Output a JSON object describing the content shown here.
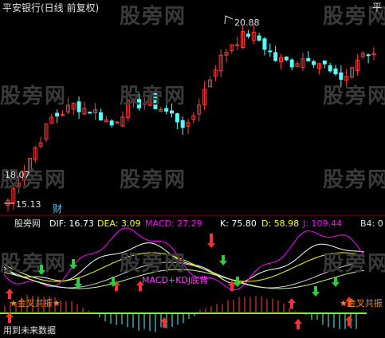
{
  "main_panel": {
    "title": "平安银行(日线 前复权)",
    "high_label": "20.88",
    "low_label": "15.13",
    "left_price": "18.07",
    "marker": "财",
    "corner_mark": "平"
  },
  "indicator_panel": {
    "name": "股旁网",
    "dif": "DIF: 16.73",
    "dea": "DEA: 3.09",
    "macd": "MACD: 27.29",
    "k": "K: 75.80",
    "d": "D: 58.98",
    "j": "J: 109.44",
    "b4": "B4: 0",
    "signal_left": "★金叉共振★",
    "signal_mid": "MACD+KDJ底背",
    "signal_right": "★金叉共振",
    "footer": "用到未来数据"
  },
  "watermark": "股旁网",
  "colors": {
    "up": "#54ffff",
    "down": "#ff3c3c",
    "dif": "#ffffff",
    "dea": "#ffff00",
    "macd": "#ff00ff",
    "k": "#ffffff",
    "d": "#ffff00",
    "j": "#ff00ff",
    "zero_line": "#7fff00",
    "arrow_up": "#ff3030",
    "arrow_down": "#2ecc40",
    "signal": "#ff8c00",
    "signal_mid": "#ff40ff"
  },
  "chart_data": {
    "type": "candlestick",
    "high": 20.88,
    "low": 15.13
  }
}
